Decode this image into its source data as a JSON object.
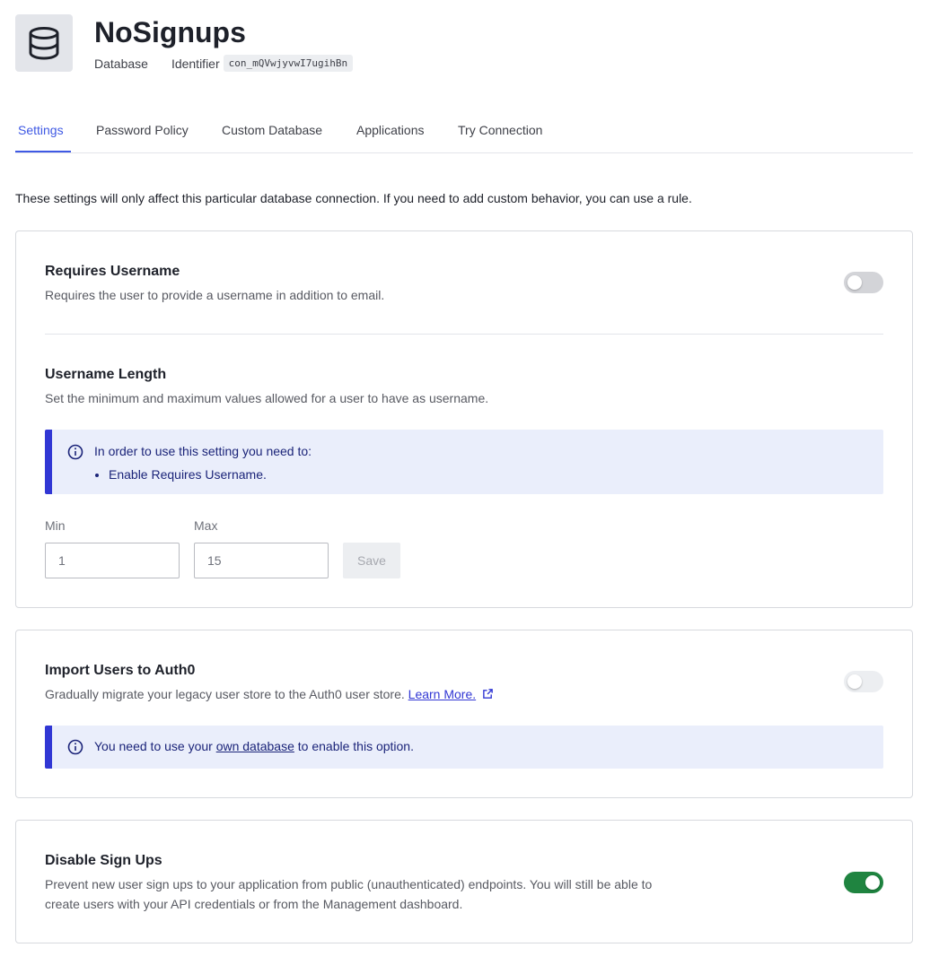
{
  "header": {
    "title": "NoSignups",
    "type_label": "Database",
    "identifier_label": "Identifier",
    "identifier_value": "con_mQVwjyvwI7ugihBn",
    "icon": "database-icon"
  },
  "tabs": [
    {
      "label": "Settings",
      "active": true
    },
    {
      "label": "Password Policy",
      "active": false
    },
    {
      "label": "Custom Database",
      "active": false
    },
    {
      "label": "Applications",
      "active": false
    },
    {
      "label": "Try Connection",
      "active": false
    }
  ],
  "intro": "These settings will only affect this particular database connection. If you need to add custom behavior, you can use a rule.",
  "requires_username": {
    "title": "Requires Username",
    "description": "Requires the user to provide a username in addition to email.",
    "enabled": false
  },
  "username_length": {
    "title": "Username Length",
    "description": "Set the minimum and maximum values allowed for a user to have as username.",
    "alert_title": "In order to use this setting you need to:",
    "alert_item": "Enable Requires Username.",
    "min_label": "Min",
    "min_value": "1",
    "max_label": "Max",
    "max_value": "15",
    "save_label": "Save"
  },
  "import_users": {
    "title": "Import Users to Auth0",
    "description": "Gradually migrate your legacy user store to the Auth0 user store.",
    "link_text": "Learn More.",
    "enabled": false,
    "alert_before": "You need to use your ",
    "alert_link": "own database",
    "alert_after": " to enable this option."
  },
  "disable_signups": {
    "title": "Disable Sign Ups",
    "description": "Prevent new user sign ups to your application from public (unauthenticated) endpoints. You will still be able to create users with your API credentials or from the Management dashboard.",
    "enabled": true
  },
  "colors": {
    "accent": "#3f59e4",
    "toggle_on": "#1f8440",
    "alert_bg": "#eaeefb",
    "alert_border": "#3137d4"
  }
}
